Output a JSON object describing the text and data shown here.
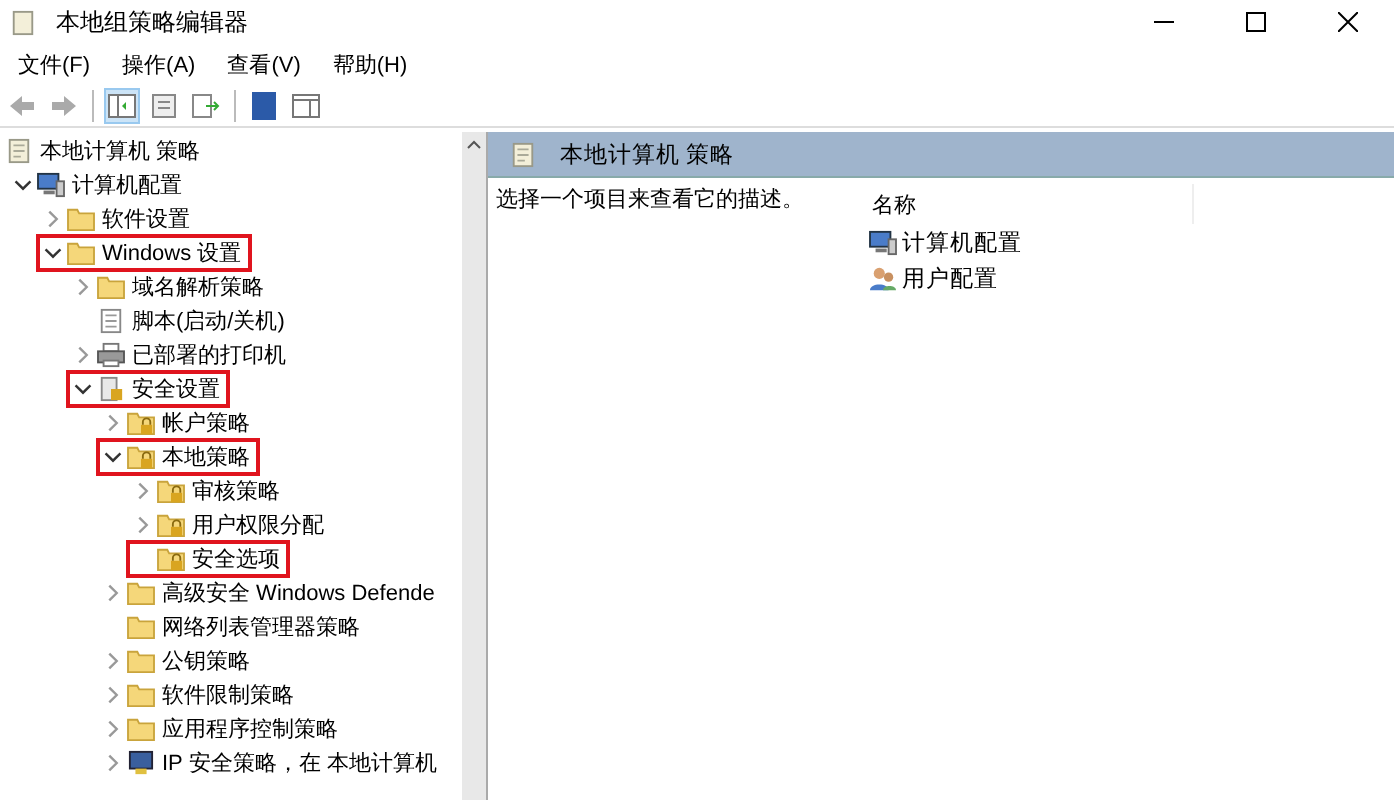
{
  "window": {
    "title": "本地组策略编辑器"
  },
  "menu": [
    "文件(F)",
    "操作(A)",
    "查看(V)",
    "帮助(H)"
  ],
  "tree": [
    {
      "label": "本地计算机 策略",
      "kind": "policy",
      "highlighted": false,
      "children": [
        {
          "label": "计算机配置",
          "kind": "computer",
          "expandable": true,
          "expanded": true,
          "highlighted": false,
          "children": [
            {
              "label": "软件设置",
              "kind": "folder",
              "expandable": true,
              "expanded": false,
              "highlighted": false
            },
            {
              "label": "Windows 设置",
              "kind": "folder",
              "expandable": true,
              "expanded": true,
              "highlighted": true,
              "children": [
                {
                  "label": "域名解析策略",
                  "kind": "folder",
                  "expandable": true,
                  "expanded": false,
                  "highlighted": false
                },
                {
                  "label": "脚本(启动/关机)",
                  "kind": "script",
                  "expandable": false,
                  "highlighted": false
                },
                {
                  "label": "已部署的打印机",
                  "kind": "printer",
                  "expandable": true,
                  "expanded": false,
                  "highlighted": false
                },
                {
                  "label": "安全设置",
                  "kind": "security",
                  "expandable": true,
                  "expanded": true,
                  "highlighted": true,
                  "children": [
                    {
                      "label": "帐户策略",
                      "kind": "lockfolder",
                      "expandable": true,
                      "expanded": false,
                      "highlighted": false
                    },
                    {
                      "label": "本地策略",
                      "kind": "lockfolder",
                      "expandable": true,
                      "expanded": true,
                      "highlighted": true,
                      "children": [
                        {
                          "label": "审核策略",
                          "kind": "lockfolder",
                          "expandable": true,
                          "expanded": false,
                          "highlighted": false
                        },
                        {
                          "label": "用户权限分配",
                          "kind": "lockfolder",
                          "expandable": true,
                          "expanded": false,
                          "highlighted": false
                        },
                        {
                          "label": "安全选项",
                          "kind": "lockfolder",
                          "expandable": false,
                          "highlighted": true
                        }
                      ]
                    },
                    {
                      "label": "高级安全 Windows Defende",
                      "kind": "folder",
                      "expandable": true,
                      "expanded": false,
                      "highlighted": false
                    },
                    {
                      "label": "网络列表管理器策略",
                      "kind": "folder",
                      "expandable": false,
                      "highlighted": false
                    },
                    {
                      "label": "公钥策略",
                      "kind": "folder",
                      "expandable": true,
                      "expanded": false,
                      "highlighted": false
                    },
                    {
                      "label": "软件限制策略",
                      "kind": "folder",
                      "expandable": true,
                      "expanded": false,
                      "highlighted": false
                    },
                    {
                      "label": "应用程序控制策略",
                      "kind": "folder",
                      "expandable": true,
                      "expanded": false,
                      "highlighted": false
                    },
                    {
                      "label": "IP 安全策略，在 本地计算机",
                      "kind": "ip",
                      "expandable": true,
                      "expanded": false,
                      "highlighted": false
                    }
                  ]
                }
              ]
            }
          ]
        }
      ]
    }
  ],
  "detail": {
    "header": "本地计算机 策略",
    "description": "选择一个项目来查看它的描述。",
    "column": "名称",
    "items": [
      {
        "label": "计算机配置",
        "kind": "computer"
      },
      {
        "label": "用户配置",
        "kind": "user"
      }
    ]
  }
}
